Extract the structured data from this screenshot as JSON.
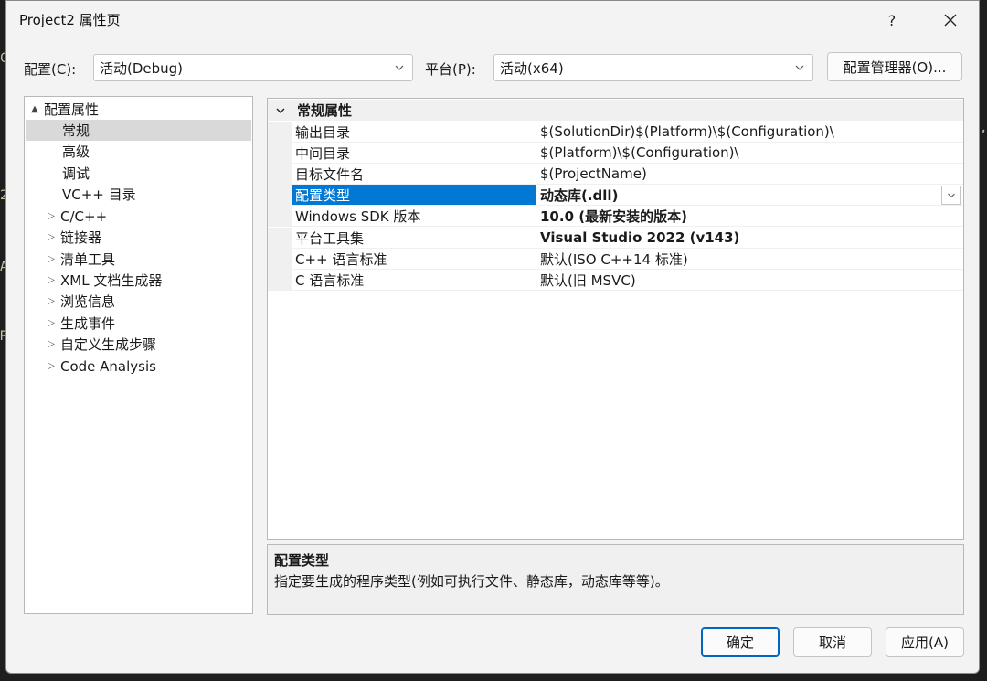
{
  "window": {
    "title": "Project2 属性页",
    "help_label": "?"
  },
  "background_glyphs": [
    "C",
    "2",
    "A",
    "R",
    ","
  ],
  "config": {
    "configuration_label": "配置(C):",
    "configuration_value": "活动(Debug)",
    "platform_label": "平台(P):",
    "platform_value": "活动(x64)",
    "manager_button": "配置管理器(O)..."
  },
  "tree": {
    "items": [
      {
        "label": "配置属性",
        "expander": "▲",
        "level": 0
      },
      {
        "label": "常规",
        "expander": "",
        "level": 1,
        "selected": true
      },
      {
        "label": "高级",
        "expander": "",
        "level": 1
      },
      {
        "label": "调试",
        "expander": "",
        "level": 1
      },
      {
        "label": "VC++ 目录",
        "expander": "",
        "level": 1
      },
      {
        "label": "C/C++",
        "expander": "▷",
        "level": 0
      },
      {
        "label": "链接器",
        "expander": "▷",
        "level": 0
      },
      {
        "label": "清单工具",
        "expander": "▷",
        "level": 0
      },
      {
        "label": "XML 文档生成器",
        "expander": "▷",
        "level": 0
      },
      {
        "label": "浏览信息",
        "expander": "▷",
        "level": 0
      },
      {
        "label": "生成事件",
        "expander": "▷",
        "level": 0
      },
      {
        "label": "自定义生成步骤",
        "expander": "▷",
        "level": 0
      },
      {
        "label": "Code Analysis",
        "expander": "▷",
        "level": 0
      }
    ]
  },
  "grid": {
    "category": "常规属性",
    "rows": [
      {
        "name": "输出目录",
        "value": "$(SolutionDir)$(Platform)\\$(Configuration)\\"
      },
      {
        "name": "中间目录",
        "value": "$(Platform)\\$(Configuration)\\"
      },
      {
        "name": "目标文件名",
        "value": "$(ProjectName)"
      },
      {
        "name": "配置类型",
        "value": "动态库(.dll)"
      },
      {
        "name": "Windows SDK 版本",
        "value": "10.0 (最新安装的版本)"
      },
      {
        "name": "平台工具集",
        "value": "Visual Studio 2022 (v143)"
      },
      {
        "name": "C++ 语言标准",
        "value": "默认(ISO C++14 标准)"
      },
      {
        "name": "C 语言标准",
        "value": "默认(旧 MSVC)"
      }
    ]
  },
  "description": {
    "title": "配置类型",
    "text": "指定要生成的程序类型(例如可执行文件、静态库，动态库等等)。"
  },
  "buttons": {
    "ok": "确定",
    "cancel": "取消",
    "apply": "应用(A)"
  }
}
